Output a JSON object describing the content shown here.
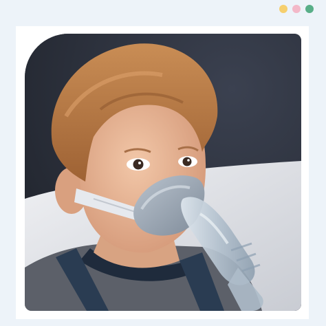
{
  "window": {
    "controls": [
      {
        "name": "minimize-dot",
        "color": "#f6cf6e"
      },
      {
        "name": "zoom-dot",
        "color": "#f3b8c8"
      },
      {
        "name": "close-dot",
        "color": "#58ae88"
      }
    ]
  },
  "photo": {
    "icon": "child-with-nebulizer-mask-image",
    "palette": {
      "background": "#2b2f3a",
      "pillow": "#e3e4e8",
      "skin": "#e8b594",
      "hair": "#b87a45",
      "shirt": "#5c6069",
      "strap": "#2a3c52",
      "mask": "#9aa7b5",
      "tube": "#c7d3dd"
    }
  }
}
